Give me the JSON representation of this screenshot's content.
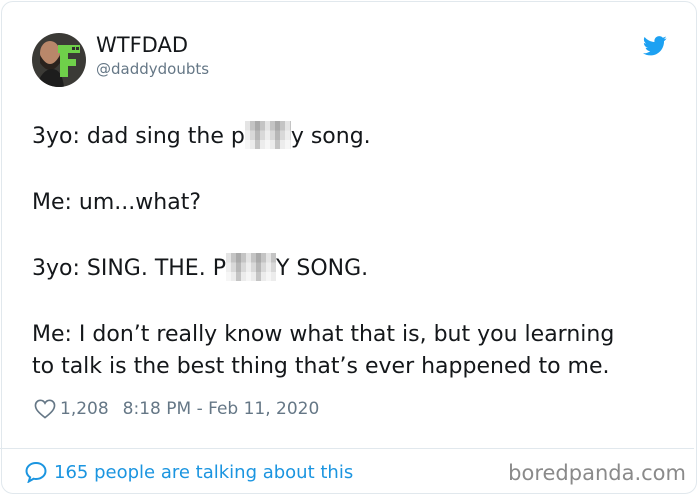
{
  "author": {
    "display_name": "WTFDAD",
    "handle": "@daddydoubts",
    "avatar_icon": "avatar-photo-with-green-f-icon"
  },
  "platform_icon": "twitter-bird-icon",
  "tweet": {
    "line1_before": "3yo: dad sing the p",
    "line1_after": "y song.",
    "line2": "Me: um...what?",
    "line3_before": "3yo: SING. THE. P",
    "line3_after": "Y SONG.",
    "line4a": "Me: I don’t really know what that is, but you learning",
    "line4b": "to talk is the best thing that’s ever happened to me."
  },
  "meta": {
    "likes": "1,208",
    "timestamp": "8:18 PM - Feb 11, 2020"
  },
  "footer": {
    "talking": "165 people are talking about this"
  },
  "watermark": "boredpanda.com",
  "colors": {
    "text": "#14171a",
    "secondary": "#657786",
    "accent": "#1b95e0",
    "twitter_blue": "#1da1f2",
    "avatar_green": "#6fd04a"
  }
}
